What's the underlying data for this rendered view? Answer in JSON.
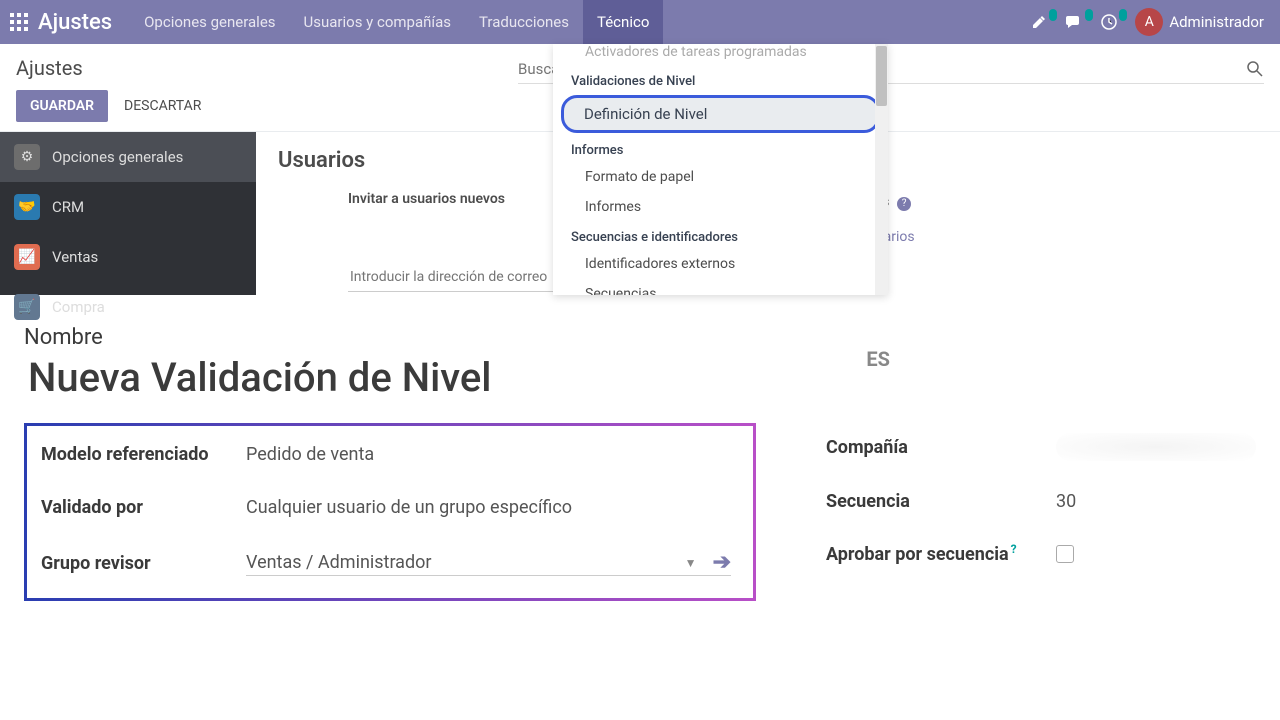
{
  "navbar": {
    "brand": "Ajustes",
    "tabs": [
      "Opciones generales",
      "Usuarios y compañías",
      "Traducciones",
      "Técnico"
    ],
    "active_tab": 3,
    "user_initial": "A",
    "user_name": "Administrador"
  },
  "control_panel": {
    "title": "Ajustes",
    "save": "GUARDAR",
    "discard": "DESCARTAR",
    "search_placeholder": "Buscar"
  },
  "dropdown": {
    "top_cut_item": "Activadores de tareas programadas",
    "sections": [
      {
        "header": "Validaciones de Nivel",
        "items": [
          "Definición de Nivel"
        ],
        "highlight": 0
      },
      {
        "header": "Informes",
        "items": [
          "Formato de papel",
          "Informes"
        ]
      },
      {
        "header": "Secuencias e identificadores",
        "items": [
          "Identificadores externos",
          "Secuencias"
        ]
      }
    ]
  },
  "sidebar": {
    "items": [
      {
        "label": "Opciones generales",
        "icon": "gear"
      },
      {
        "label": "CRM",
        "icon": "crm"
      },
      {
        "label": "Ventas",
        "icon": "chart"
      },
      {
        "label": "Compra",
        "icon": "cart"
      }
    ],
    "active": 0
  },
  "main": {
    "section": "Usuarios",
    "invite_label": "Invitar a usuarios nuevos",
    "active_users_label": "Usuarios activos",
    "manage_users": "Administrar usuarios",
    "email_placeholder": "Introducir la dirección de correo"
  },
  "form": {
    "name_label": "Nombre",
    "title": "Nueva Validación de Nivel",
    "lang_badge": "ES",
    "left": {
      "model_ref": {
        "label": "Modelo referenciado",
        "value": "Pedido de venta"
      },
      "validated_by": {
        "label": "Validado por",
        "value": "Cualquier usuario de un grupo específico"
      },
      "reviewer_group": {
        "label": "Grupo revisor",
        "value": "Ventas / Administrador"
      }
    },
    "right": {
      "company": {
        "label": "Compañía"
      },
      "sequence": {
        "label": "Secuencia",
        "value": "30"
      },
      "approve_seq": {
        "label": "Aprobar por secuencia"
      }
    }
  }
}
